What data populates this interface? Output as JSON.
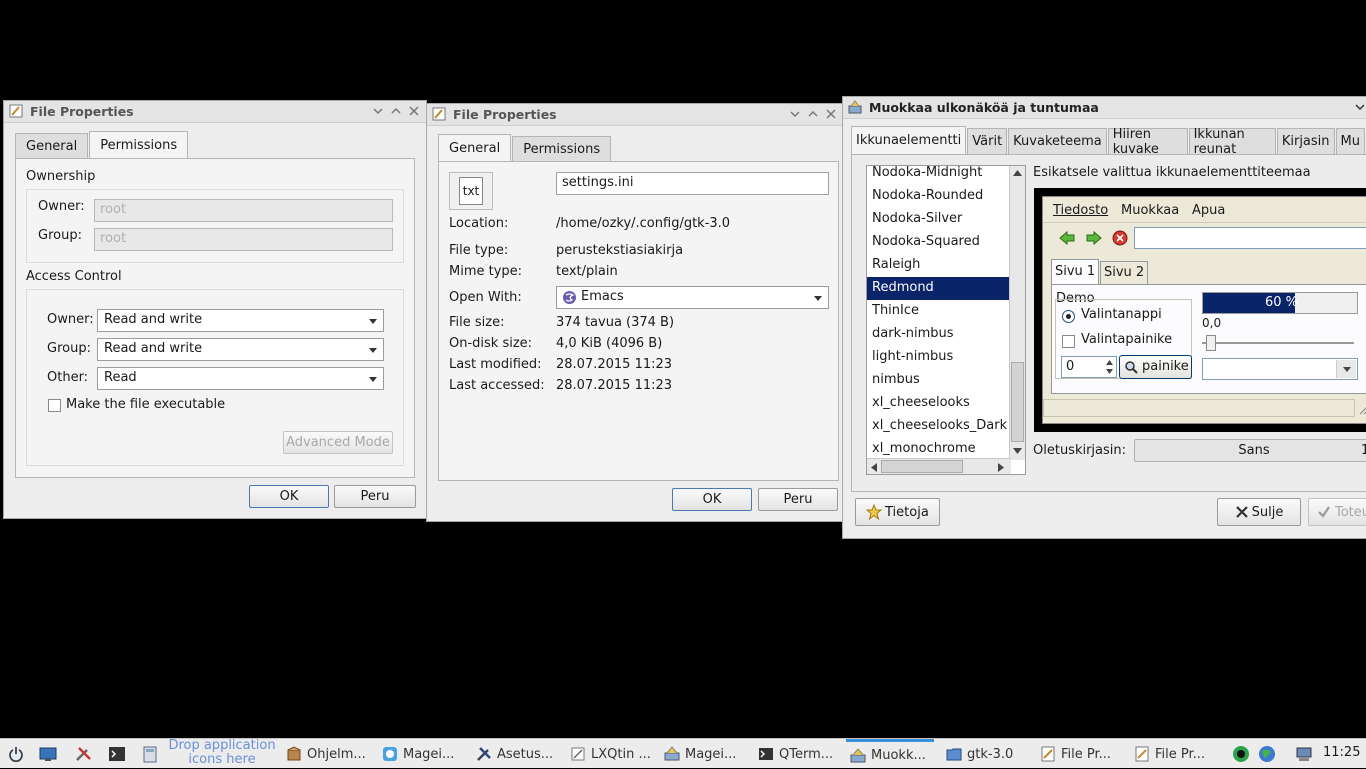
{
  "win1": {
    "title": "File Properties",
    "tabs": [
      "General",
      "Permissions"
    ],
    "ownership_label": "Ownership",
    "owner_label": "Owner:",
    "owner_value": "root",
    "group_label": "Group:",
    "group_value": "root",
    "access_label": "Access Control",
    "ac_owner_label": "Owner:",
    "ac_owner_value": "Read and write",
    "ac_group_label": "Group:",
    "ac_group_value": "Read and write",
    "ac_other_label": "Other:",
    "ac_other_value": "Read",
    "executable_label": "Make the file executable",
    "advanced_label": "Advanced Mode",
    "ok_label": "OK",
    "cancel_label": "Peru"
  },
  "win2": {
    "title": "File Properties",
    "tabs": [
      "General",
      "Permissions"
    ],
    "file_icon_text": "txt",
    "filename": "settings.ini",
    "location_label": "Location:",
    "location_value": "/home/ozky/.config/gtk-3.0",
    "filetype_label": "File type:",
    "filetype_value": "perustekstiasiakirja",
    "mime_label": "Mime type:",
    "mime_value": "text/plain",
    "openwith_label": "Open With:",
    "openwith_value": "Emacs",
    "filesize_label": "File size:",
    "filesize_value": "374 tavua (374 B)",
    "disksize_label": "On-disk size:",
    "disksize_value": "4,0 KiB (4096 B)",
    "modified_label": "Last modified:",
    "modified_value": "28.07.2015 11:23",
    "accessed_label": "Last accessed:",
    "accessed_value": "28.07.2015 11:23",
    "ok_label": "OK",
    "cancel_label": "Peru"
  },
  "win3": {
    "title": "Muokkaa ulkonäköä ja tuntumaa",
    "tabs": [
      "Ikkunaelementti",
      "Värit",
      "Kuvaketeema",
      "Hiiren kuvake",
      "Ikkunan reunat",
      "Kirjasin",
      "Mu"
    ],
    "themes": [
      "Nodoka-Midnight",
      "Nodoka-Rounded",
      "Nodoka-Silver",
      "Nodoka-Squared",
      "Raleigh",
      "Redmond",
      "ThinIce",
      "dark-nimbus",
      "light-nimbus",
      "nimbus",
      "xl_cheeselooks",
      "xl_cheeselooks_Dark",
      "xl_monochrome"
    ],
    "selected_theme": "Redmond",
    "preview_label": "Esikatsele valittua ikkunaelementtiteemaa",
    "menu": [
      "Tiedosto",
      "Muokkaa",
      "Apua"
    ],
    "preview_tabs": [
      "Sivu 1",
      "Sivu 2"
    ],
    "demo_label": "Demo",
    "radio_label": "Valintanappi",
    "check_label": "Valintapainike",
    "spin_value": "0",
    "button_label": "painike",
    "progress_text": "60 %",
    "progress_value": 0.6,
    "scale_value": "0,0",
    "font_label": "Oletuskirjasin:",
    "font_value": "Sans",
    "font_size": "1",
    "about_label": "Tietoja",
    "close_label": "Sulje",
    "apply_label": "Toteu"
  },
  "taskbar": {
    "drop_hint": "Drop application icons here",
    "tasks": [
      "Ohjelm...",
      "Magei...",
      "Asetus...",
      "LXQtin ...",
      "Magei...",
      "QTerm...",
      "Muokk...",
      "gtk-3.0",
      "File Pr...",
      "File Pr..."
    ],
    "clock": "11:25"
  },
  "colors": {
    "selection": "#0a246a",
    "taskbar_active": "#3b8fd8"
  }
}
